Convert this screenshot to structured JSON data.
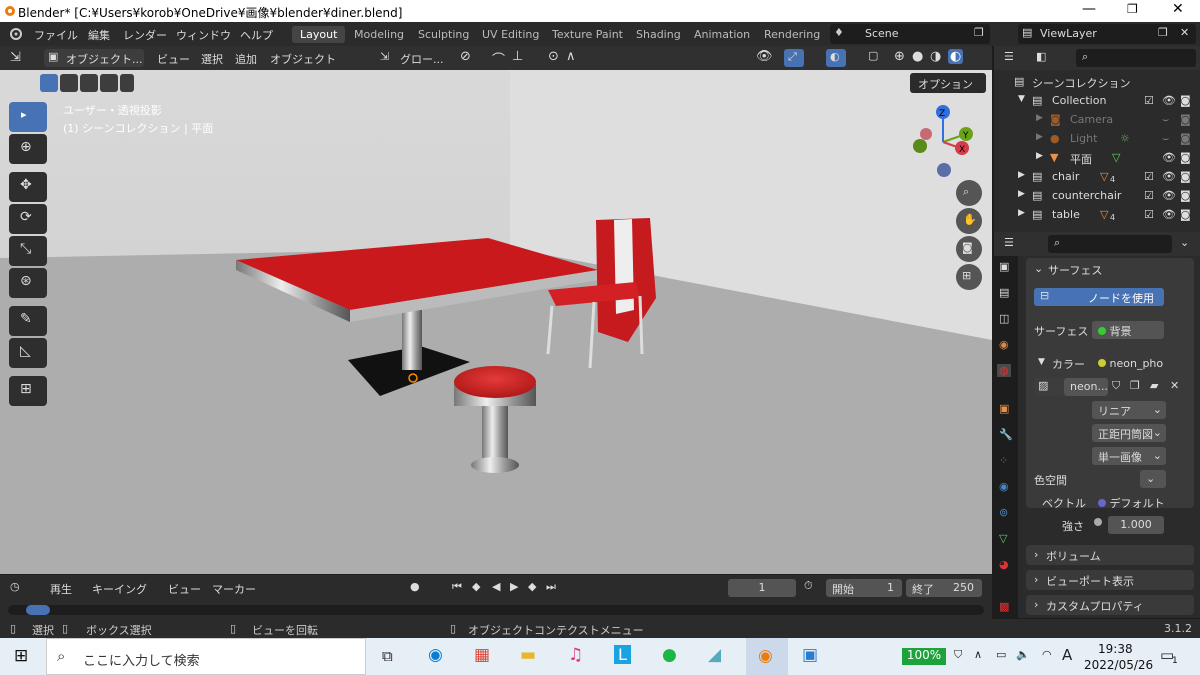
{
  "window": {
    "title": "Blender* [C:¥Users¥korob¥OneDrive¥画像¥blender¥diner.blend]"
  },
  "menu": [
    "ファイル",
    "編集",
    "レンダー",
    "ウィンドウ",
    "ヘルプ"
  ],
  "workspaces": [
    "Layout",
    "Modeling",
    "Sculpting",
    "UV Editing",
    "Texture Paint",
    "Shading",
    "Animation",
    "Rendering"
  ],
  "scene": "Scene",
  "view_layer": "ViewLayer",
  "viewport": {
    "mode": "オブジェクト...",
    "menus": [
      "ビュー",
      "選択",
      "追加",
      "オブジェクト"
    ],
    "orientation": "グロー...",
    "options": "オプション",
    "view_label": "ユーザー・透視投影",
    "collection_label": "(1) シーンコレクション | 平面"
  },
  "outliner": {
    "root": "シーンコレクション",
    "items": [
      {
        "name": "Collection"
      },
      {
        "name": "Camera"
      },
      {
        "name": "Light"
      },
      {
        "name": "平面"
      },
      {
        "name": "chair",
        "count": "4"
      },
      {
        "name": "counterchair"
      },
      {
        "name": "table",
        "count": "4"
      }
    ]
  },
  "properties": {
    "surface_panel": "サーフェス",
    "use_nodes": "ノードを使用",
    "surface_label": "サーフェス",
    "surface_value": "背景",
    "color_label": "カラー",
    "color_value": "neon_pho",
    "image_name": "neon...",
    "interp": "リニア",
    "projection": "正距円筒図",
    "source": "単一画像",
    "colorspace_label": "色空間",
    "vector_label": "ベクトル",
    "vector_value": "デフォルト",
    "strength_label": "強さ",
    "strength_value": "1.000",
    "volume": "ボリューム",
    "viewport_display": "ビューポート表示",
    "custom_props": "カスタムプロパティ"
  },
  "timeline": {
    "playback": "再生",
    "keying": "キーイング",
    "view": "ビュー",
    "marker": "マーカー",
    "current_frame": "1",
    "start_label": "開始",
    "start": "1",
    "end_label": "終了",
    "end": "250"
  },
  "statusbar": {
    "select": "選択",
    "box_select": "ボックス選択",
    "rotate": "ビューを回転",
    "context": "オブジェクトコンテクストメニュー",
    "version": "3.1.2"
  },
  "taskbar": {
    "search_placeholder": "ここに入力して検索",
    "battery": "100%",
    "ime": "A",
    "time": "19:38",
    "date": "2022/05/26",
    "notifications": "1"
  }
}
